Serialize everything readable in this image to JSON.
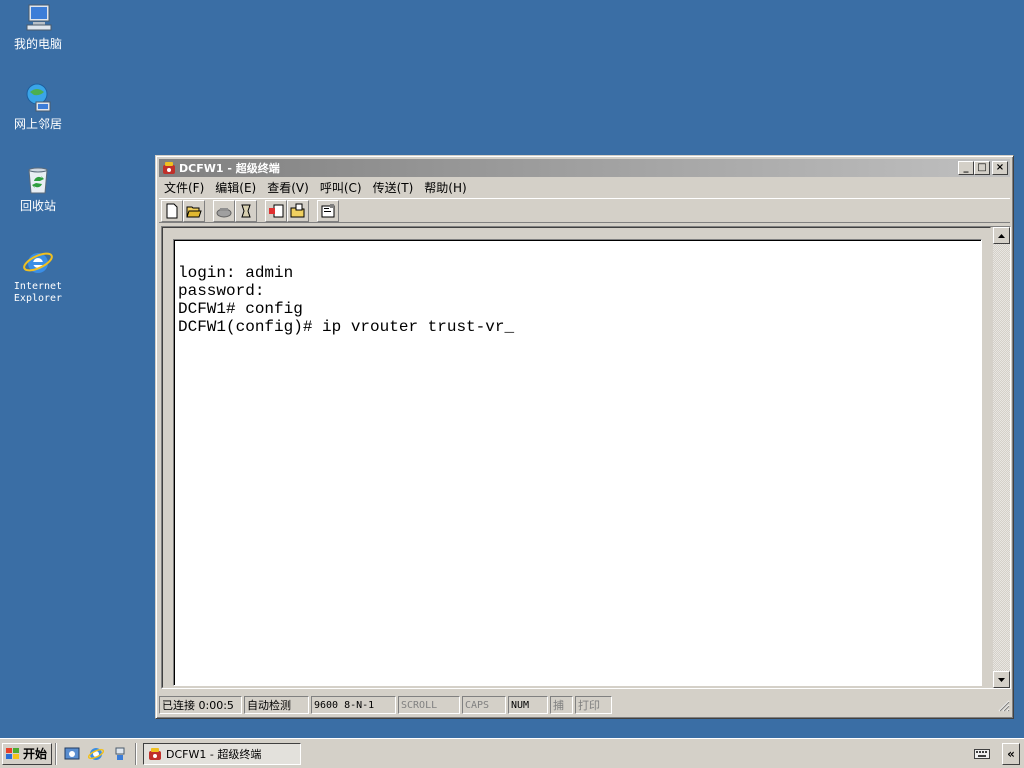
{
  "desktop": {
    "icons": [
      {
        "label": "我的电脑",
        "icon": "my-computer-icon"
      },
      {
        "label": "网上邻居",
        "icon": "network-places-icon"
      },
      {
        "label": "回收站",
        "icon": "recycle-bin-icon"
      },
      {
        "label": "Internet\nExplorer",
        "icon": "internet-explorer-icon"
      }
    ],
    "background_color": "#3a6ea5"
  },
  "window": {
    "title": "DCFW1 - 超级终端",
    "controls": {
      "minimize": "_",
      "maximize": "□",
      "close": "×"
    },
    "menu": [
      "文件(F)",
      "编辑(E)",
      "查看(V)",
      "呼叫(C)",
      "传送(T)",
      "帮助(H)"
    ],
    "toolbar": [
      "new-connection-icon",
      "open-icon",
      "disconnect-icon",
      "dial-icon",
      "send-icon",
      "receive-icon",
      "properties-icon"
    ]
  },
  "terminal": {
    "text": "login: admin\npassword:\nDCFW1# config\nDCFW1(config)# ip vrouter trust-vr_"
  },
  "statusbar": {
    "connected": "已连接 0:00:5",
    "detect": "自动检测",
    "port_settings": "9600 8-N-1",
    "scroll": "SCROLL",
    "caps": "CAPS",
    "num": "NUM",
    "capture": "捕",
    "print": "打印"
  },
  "taskbar": {
    "start_label": "开始",
    "task_title": "DCFW1 - 超级终端",
    "expand_label": "«"
  }
}
